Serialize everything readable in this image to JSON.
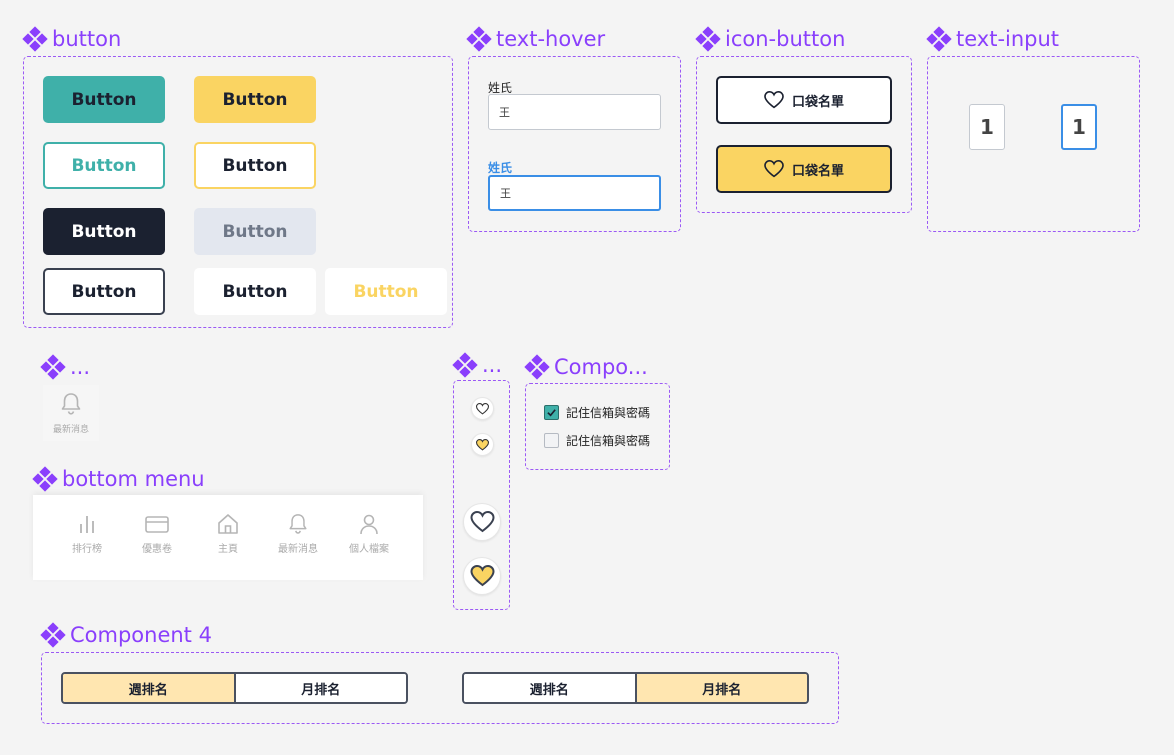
{
  "colors": {
    "teal": "#3fb0a9",
    "yellow": "#fad462",
    "dark": "#1b2130",
    "disabled_bg": "#e3e7ef",
    "disabled_text": "#6f7888",
    "purple": "#8a3ffc",
    "focus_blue": "#3a8ee6",
    "segment_active": "#ffe6b0"
  },
  "sections": {
    "button": "button",
    "text_hover": "text-hover",
    "icon_button": "icon-button",
    "text_input": "text-input",
    "notification": "...",
    "hearts": "...",
    "checkbox": "Compo...",
    "bottom_menu": "bottom menu",
    "component4": "Component 4"
  },
  "buttons": {
    "teal_filled": "Button",
    "yellow_filled": "Button",
    "teal_outline": "Button",
    "yellow_outline": "Button",
    "dark_filled": "Button",
    "disabled": "Button",
    "dark_outline": "Button",
    "white_plain": "Button",
    "white_yellow_text": "Button"
  },
  "text_hover": {
    "label_default": "姓氏",
    "value_default": "王",
    "label_focused": "姓氏",
    "value_focused": "王"
  },
  "icon_button": {
    "label_outline": "口袋名單",
    "label_filled": "口袋名單",
    "icon": "heart-icon"
  },
  "text_input": {
    "value_default": "1",
    "value_focused": "1"
  },
  "notification": {
    "label": "最新消息",
    "icon": "bell-icon"
  },
  "checkbox": {
    "checked_label": "記住信箱與密碼",
    "unchecked_label": "記住信箱與密碼"
  },
  "bottom_menu": {
    "items": [
      {
        "label": "排行榜",
        "icon": "bar-chart-icon"
      },
      {
        "label": "優惠卷",
        "icon": "credit-card-icon"
      },
      {
        "label": "主頁",
        "icon": "home-icon"
      },
      {
        "label": "最新消息",
        "icon": "bell-icon"
      },
      {
        "label": "個人檔案",
        "icon": "user-icon"
      }
    ]
  },
  "component4": {
    "weekly_tab": "週排名",
    "monthly_tab": "月排名",
    "first_active": "週排名",
    "second_active": "月排名"
  }
}
